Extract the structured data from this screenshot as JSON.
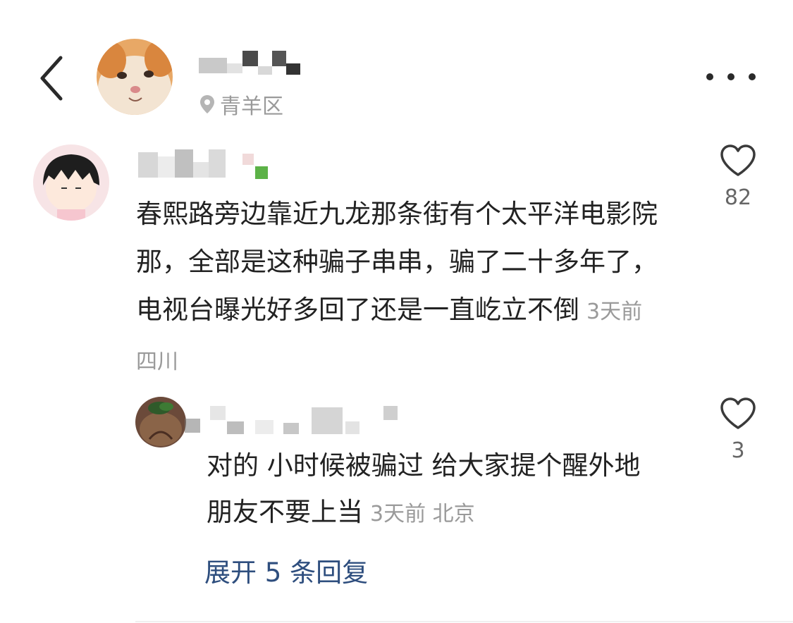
{
  "header": {
    "back_icon": "chevron-left-icon",
    "location": "青羊区",
    "location_icon": "location-pin-icon",
    "more_icon": "more-horizontal-icon"
  },
  "comments": [
    {
      "text": "春熙路旁边靠近九龙那条街有个太平洋电影院那，全部是这种骗子串串，骗了二十多年了，电视台曝光好多回了还是一直屹立不倒",
      "time": "3天前",
      "region": "四川",
      "likes": "82"
    }
  ],
  "reply": {
    "text": "对的 小时候被骗过 给大家提个醒外地朋友不要上当",
    "time": "3天前",
    "region": "北京",
    "likes": "3"
  },
  "expand_label": "展开 5 条回复",
  "colors": {
    "meta": "#9a9a9a",
    "link": "#2e4e7e",
    "text": "#222222"
  }
}
